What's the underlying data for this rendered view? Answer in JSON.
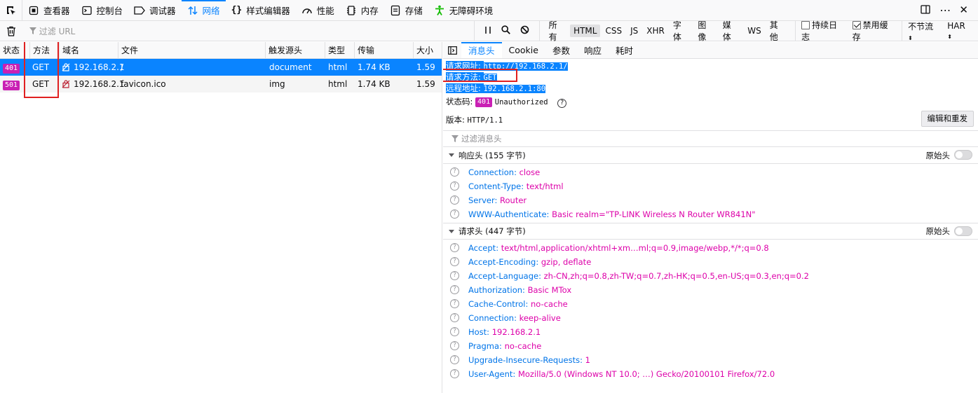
{
  "toolbar": {
    "tabs": [
      {
        "label": "查看器",
        "icon": "inspector-icon"
      },
      {
        "label": "控制台",
        "icon": "console-icon"
      },
      {
        "label": "调试器",
        "icon": "debugger-icon"
      },
      {
        "label": "网络",
        "icon": "network-icon",
        "selected": true
      },
      {
        "label": "样式编辑器",
        "icon": "style-editor-icon"
      },
      {
        "label": "性能",
        "icon": "performance-icon"
      },
      {
        "label": "内存",
        "icon": "memory-icon"
      },
      {
        "label": "存储",
        "icon": "storage-icon"
      },
      {
        "label": "无障碍环境",
        "icon": "accessibility-icon"
      }
    ]
  },
  "filterbar": {
    "url_placeholder": "过滤 URL",
    "types": [
      "所有",
      "HTML",
      "CSS",
      "JS",
      "XHR",
      "字体",
      "图像",
      "媒体",
      "WS",
      "其他"
    ],
    "active_type": "HTML",
    "persist_logs": "持续日志",
    "disable_cache": "禁用缓存",
    "throttle": "不节流",
    "har": "HAR"
  },
  "table": {
    "headers": [
      "状态",
      "方法",
      "域名",
      "文件",
      "触发源头",
      "类型",
      "传输",
      "大小"
    ],
    "rows": [
      {
        "status": "401",
        "method": "GET",
        "domain": "192.168.2.1",
        "file": "/",
        "cause": "document",
        "type": "html",
        "transferred": "1.74 KB",
        "size": "1.59"
      },
      {
        "status": "501",
        "method": "GET",
        "domain": "192.168.2.1",
        "file": "favicon.ico",
        "cause": "img",
        "type": "html",
        "transferred": "1.74 KB",
        "size": "1.59"
      }
    ]
  },
  "detail": {
    "tabs": [
      "消息头",
      "Cookie",
      "参数",
      "响应",
      "耗时"
    ],
    "summary": {
      "url_label": "请求网址:",
      "url_value": "http://192.168.2.1/",
      "method_label": "请求方法:",
      "method_value": "GET",
      "remote_label": "远程地址:",
      "remote_value": "192.168.2.1:80",
      "status_label": "状态码:",
      "status_code": "401",
      "status_text": "Unauthorized",
      "version_label": "版本:",
      "version_value": "HTTP/1.1"
    },
    "edit_resend": "编辑和重发",
    "filter_headers": "过滤消息头",
    "response_section": "响应头 (155 字节)",
    "request_section": "请求头 (447 字节)",
    "raw_label": "原始头",
    "response_headers": [
      {
        "name": "Connection:",
        "value": "close"
      },
      {
        "name": "Content-Type:",
        "value": "text/html"
      },
      {
        "name": "Server:",
        "value": "Router"
      },
      {
        "name": "WWW-Authenticate:",
        "value": "Basic realm=\"TP-LINK Wireless N Router WR841N\""
      }
    ],
    "request_headers": [
      {
        "name": "Accept:",
        "value": "text/html,application/xhtml+xm…ml;q=0.9,image/webp,*/*;q=0.8"
      },
      {
        "name": "Accept-Encoding:",
        "value": "gzip, deflate"
      },
      {
        "name": "Accept-Language:",
        "value": "zh-CN,zh;q=0.8,zh-TW;q=0.7,zh-HK;q=0.5,en-US;q=0.3,en;q=0.2"
      },
      {
        "name": "Authorization:",
        "value": "Basic MTox"
      },
      {
        "name": "Cache-Control:",
        "value": "no-cache"
      },
      {
        "name": "Connection:",
        "value": "keep-alive"
      },
      {
        "name": "Host:",
        "value": "192.168.2.1"
      },
      {
        "name": "Pragma:",
        "value": "no-cache"
      },
      {
        "name": "Upgrade-Insecure-Requests:",
        "value": "1"
      },
      {
        "name": "User-Agent:",
        "value": "Mozilla/5.0 (Windows NT 10.0; …) Gecko/20100101 Firefox/72.0"
      }
    ]
  },
  "colors": {
    "accent": "#0a84ff",
    "status_badge": "#c920b4",
    "header_name": "#0074e8",
    "header_value": "#dd00a9",
    "annotation": "#e02020"
  }
}
